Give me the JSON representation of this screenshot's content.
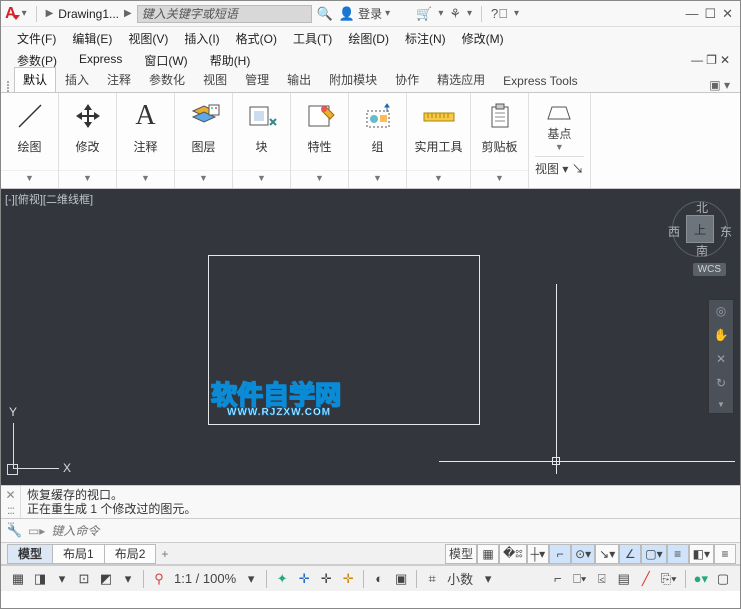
{
  "titlebar": {
    "doc": "Drawing1...",
    "search_ph": "键入关键字或短语",
    "login": "登录"
  },
  "menus": {
    "row1": [
      "文件(F)",
      "编辑(E)",
      "视图(V)",
      "插入(I)",
      "格式(O)",
      "工具(T)",
      "绘图(D)",
      "标注(N)",
      "修改(M)"
    ],
    "row2": [
      "参数(P)",
      "Express",
      "窗口(W)",
      "帮助(H)"
    ]
  },
  "ribbon_tabs": [
    "默认",
    "插入",
    "注释",
    "参数化",
    "视图",
    "管理",
    "输出",
    "附加模块",
    "协作",
    "精选应用",
    "Express Tools"
  ],
  "panels": [
    {
      "label": "绘图"
    },
    {
      "label": "修改"
    },
    {
      "label": "注释"
    },
    {
      "label": "图层"
    },
    {
      "label": "块"
    },
    {
      "label": "特性"
    },
    {
      "label": "组"
    },
    {
      "label": "实用工具"
    },
    {
      "label": "剪贴板"
    }
  ],
  "side": {
    "base": "基点",
    "view": "视图 ▾ ↘"
  },
  "viewport": {
    "label": "[-][俯视][二维线框]",
    "wcs": "WCS",
    "cube": "上",
    "n": "北",
    "s": "南",
    "e": "东",
    "w": "西"
  },
  "ucs": {
    "x": "X",
    "y": "Y"
  },
  "watermark": {
    "main": "软件自学网",
    "sub": "WWW.RJZXW.COM"
  },
  "cmd_history": [
    "恢复缓存的视口。",
    "正在重生成 1 个修改过的图元。"
  ],
  "cmd_prompt": "键入命令",
  "model_tabs": [
    "模型",
    "布局1",
    "布局2"
  ],
  "status": {
    "model": "模型",
    "scale": "1:1 / 100%",
    "snap": "小数"
  }
}
